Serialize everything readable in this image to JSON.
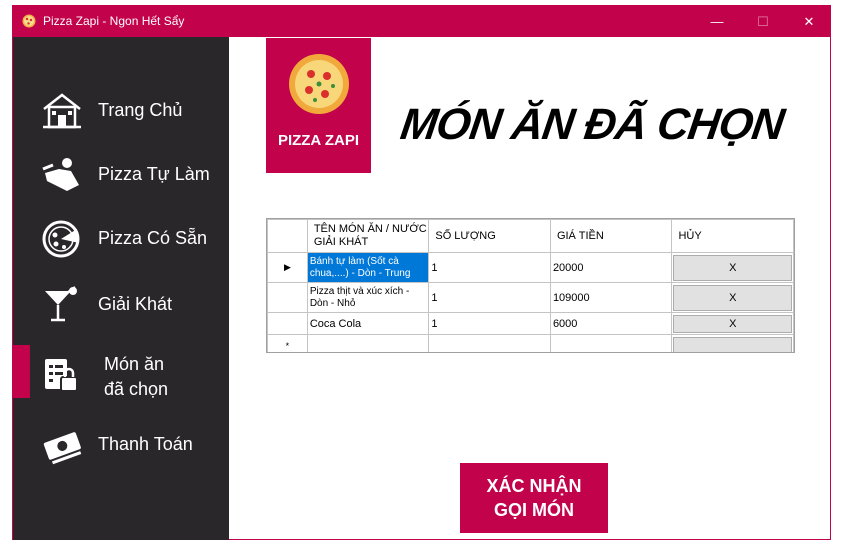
{
  "window": {
    "title": "Pizza Zapi - Ngon Hết Sẩy",
    "minimize": "—",
    "maximize": "☐",
    "close": "✕"
  },
  "sidebar": {
    "items": [
      {
        "label": "Trang Chủ",
        "icon": "house-icon"
      },
      {
        "label": "Pizza Tự Làm",
        "icon": "chef-icon"
      },
      {
        "label": "Pizza Có Sẵn",
        "icon": "pizza-icon"
      },
      {
        "label": "Giải Khát",
        "icon": "cocktail-icon"
      },
      {
        "label_line1": "Món ăn",
        "label_line2": "đã chọn",
        "icon": "order-list-icon",
        "active": true
      },
      {
        "label": "Thanh Toán",
        "icon": "money-icon"
      }
    ]
  },
  "logo": {
    "text": "PIZZA ZAPI"
  },
  "heading": "MÓN ĂN ĐÃ CHỌN",
  "table": {
    "columns": [
      "TÊN MÓN ĂN / NƯỚC GIẢI KHÁT",
      "SỐ LƯỢNG",
      "GIÁ TIỀN",
      "HỦY"
    ],
    "rows": [
      {
        "name": "Bánh tự làm (Sốt cà chua,....) - Dòn - Trung",
        "qty": "1",
        "price": "20000",
        "cancel": "X"
      },
      {
        "name": "Pizza thịt và xúc xích - Dòn - Nhỏ",
        "qty": "1",
        "price": "109000",
        "cancel": "X"
      },
      {
        "name": "Coca Cola",
        "qty": "1",
        "price": "6000",
        "cancel": "X"
      }
    ],
    "current_row_marker": "▶",
    "new_row_marker": "*"
  },
  "confirm_button": {
    "line1": "XÁC NHẬN",
    "line2": "GỌI MÓN"
  },
  "colors": {
    "accent": "#c2024a",
    "sidebar": "#29272a",
    "selection": "#0078d7"
  }
}
